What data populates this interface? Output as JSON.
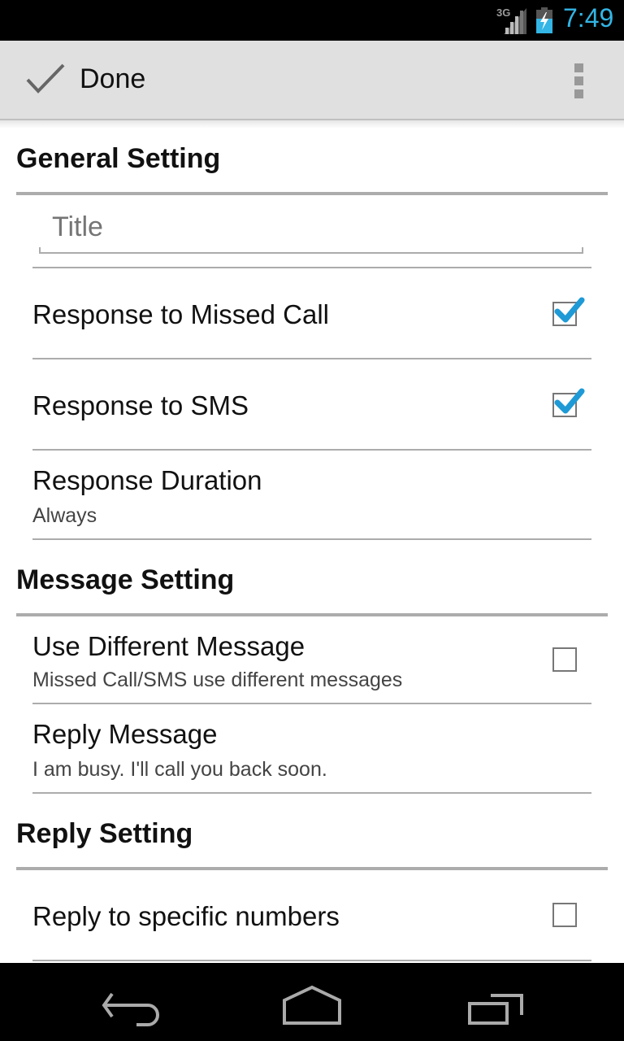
{
  "status_bar": {
    "network_type": "3G",
    "time": "7:49",
    "icons": [
      "signal-icon",
      "battery-charging-icon"
    ],
    "time_color": "#33b5e5"
  },
  "action_bar": {
    "done_label": "Done",
    "done_icon": "checkmark-icon",
    "overflow_icon": "overflow-menu-icon"
  },
  "sections": [
    {
      "title": "General Setting",
      "title_field": {
        "value": "",
        "placeholder": "Title"
      },
      "items": [
        {
          "title": "Response to Missed Call",
          "checkbox": true,
          "checked": true
        },
        {
          "title": "Response to SMS",
          "checkbox": true,
          "checked": true
        },
        {
          "title": "Response Duration",
          "summary": "Always"
        }
      ]
    },
    {
      "title": "Message Setting",
      "items": [
        {
          "title": "Use Different Message",
          "summary": "Missed Call/SMS use different messages",
          "checkbox": true,
          "checked": false
        },
        {
          "title": "Reply Message",
          "summary": "I am busy. I'll call you back soon."
        }
      ]
    },
    {
      "title": "Reply Setting",
      "items": [
        {
          "title": "Reply to specific numbers",
          "checkbox": true,
          "checked": false
        }
      ]
    }
  ],
  "nav_bar": {
    "buttons": [
      "back",
      "home",
      "recent-apps"
    ]
  },
  "colors": {
    "accent": "#33b5e5",
    "check_blue": "#1e9ad6",
    "divider": "#acacac"
  }
}
